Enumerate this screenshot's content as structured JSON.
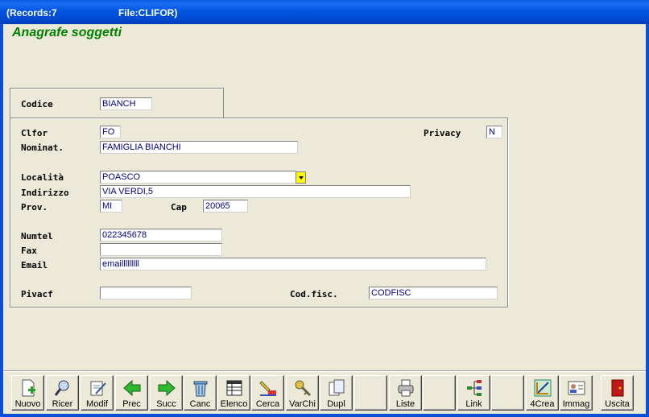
{
  "titlebar": {
    "records": "(Records:7",
    "file": "File:CLIFOR)"
  },
  "app_title": "Anagrafe soggetti",
  "form": {
    "codice": {
      "label": "Codice",
      "value": "BIANCH"
    },
    "clfor": {
      "label": "Clfor",
      "value": "FO"
    },
    "privacy": {
      "label": "Privacy",
      "value": "N"
    },
    "nominat": {
      "label": "Nominat.",
      "value": "FAMIGLIA BIANCHI"
    },
    "localita": {
      "label": "Località",
      "value": "POASCO"
    },
    "indirizzo": {
      "label": "Indirizzo",
      "value": "VIA VERDI,5"
    },
    "prov": {
      "label": "Prov.",
      "value": "MI"
    },
    "cap": {
      "label": "Cap",
      "value": "20065"
    },
    "numtel": {
      "label": "Numtel",
      "value": "022345678"
    },
    "fax": {
      "label": "Fax",
      "value": ""
    },
    "email": {
      "label": "Email",
      "value": "emailllllllll"
    },
    "pivacf": {
      "label": "Pivacf",
      "value": ""
    },
    "codfisc": {
      "label": "Cod.fisc.",
      "value": "CODFISC"
    }
  },
  "toolbar": {
    "nuovo": "Nuovo",
    "ricer": "Ricer",
    "modif": "Modif",
    "prec": "Prec",
    "succ": "Succ",
    "canc": "Canc",
    "elenco": "Elenco",
    "cerca": "Cerca",
    "varchi": "VarChi",
    "dupl": "Dupl",
    "liste": "Liste",
    "link": "Link",
    "crea4": "4Crea",
    "immag": "Immag",
    "uscita": "Uscita"
  },
  "colors": {
    "title_green": "#008000",
    "field_text": "#000080",
    "window_bg": "#ece9d8",
    "titlebar": "#0053e0"
  }
}
